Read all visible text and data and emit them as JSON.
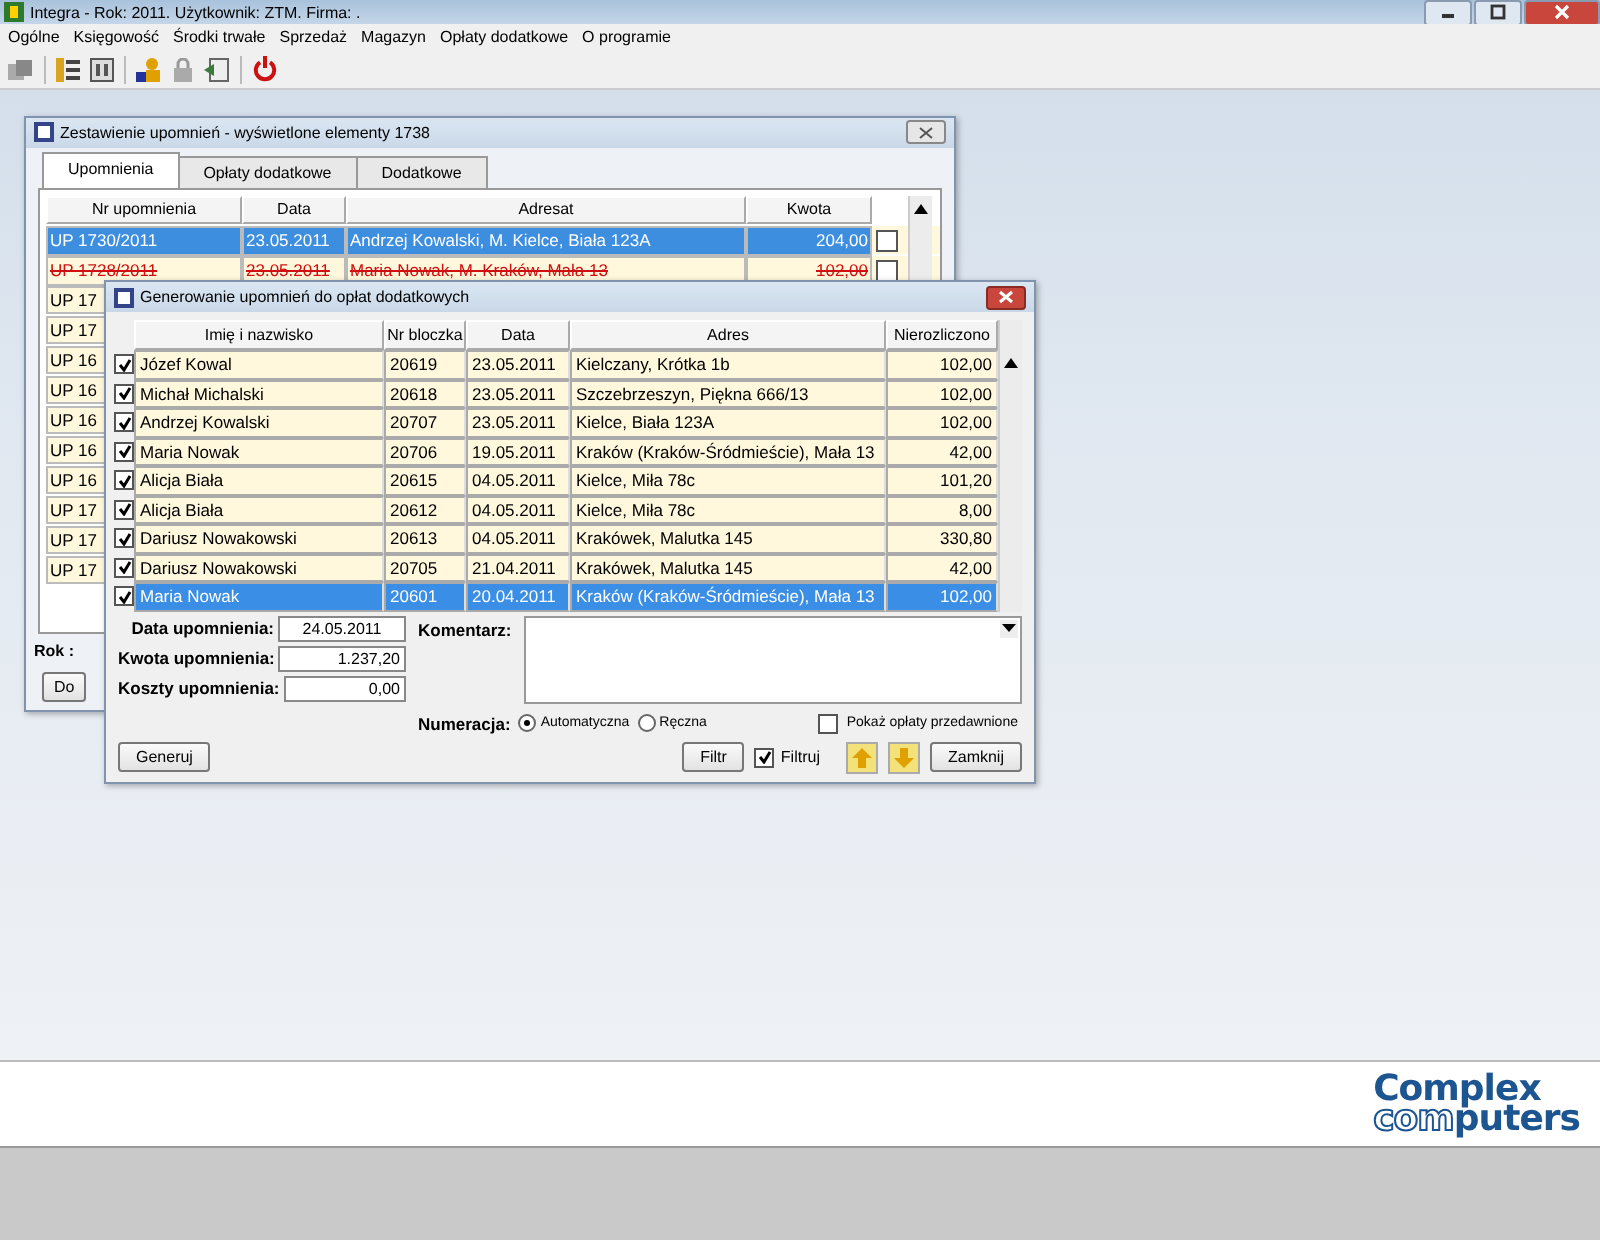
{
  "app": {
    "title": "Integra -  Rok: 2011. Użytkownik: ZTM. Firma: ."
  },
  "menu": [
    "Ogólne",
    "Księgowość",
    "Środki trwałe",
    "Sprzedaż",
    "Magazyn",
    "Opłaty dodatkowe",
    "O programie"
  ],
  "list_window": {
    "title": "Zestawienie upomnień - wyświetlone elementy 1738",
    "tabs": [
      {
        "label": "Upomnienia",
        "selected": true
      },
      {
        "label": "Opłaty dodatkowe",
        "selected": false
      },
      {
        "label": "Dodatkowe",
        "selected": false
      }
    ],
    "columns": [
      "Nr upomnienia",
      "Data",
      "Adresat",
      "Kwota"
    ],
    "rows": [
      {
        "number": "UP 1730/2011",
        "date": "23.05.2011",
        "addressee": "Andrzej Kowalski, M. Kielce, Biała 123A",
        "amount": "204,00",
        "selected": true,
        "cancelled": false,
        "checked": false
      },
      {
        "number": "UP 1728/2011",
        "date": "23.05.2011",
        "addressee": "Maria Nowak, M. Kraków, Mała 13",
        "amount": "102,00",
        "selected": false,
        "cancelled": true,
        "checked": false
      },
      {
        "number": "UP 17",
        "selected": false,
        "cancelled": false
      },
      {
        "number": "UP 17",
        "selected": false,
        "cancelled": false
      },
      {
        "number": "UP 16",
        "selected": false,
        "cancelled": false
      },
      {
        "number": "UP 16",
        "selected": false,
        "cancelled": false
      },
      {
        "number": "UP 16",
        "selected": false,
        "cancelled": false
      },
      {
        "number": "UP 16",
        "selected": false,
        "cancelled": false
      },
      {
        "number": "UP 16",
        "selected": false,
        "cancelled": false
      },
      {
        "number": "UP 17",
        "selected": false,
        "cancelled": false
      },
      {
        "number": "UP 17",
        "selected": false,
        "cancelled": false
      },
      {
        "number": "UP 17",
        "selected": false,
        "cancelled": false
      }
    ],
    "year_label": "Rok :",
    "button": "Do"
  },
  "dialog": {
    "title": "Generowanie upomnień do opłat dodatkowych",
    "columns": [
      "Imię i nazwisko",
      "Nr bloczka",
      "Data",
      "Adres",
      "Nierozliczono"
    ],
    "rows": [
      {
        "checked": true,
        "name": "Józef Kowal",
        "block": "20619",
        "date": "23.05.2011",
        "address": "Kielczany, Krótka 1b",
        "amount": "102,00",
        "selected": false
      },
      {
        "checked": true,
        "name": "Michał Michalski",
        "block": "20618",
        "date": "23.05.2011",
        "address": "Szczebrzeszyn, Piękna 666/13",
        "amount": "102,00",
        "selected": false
      },
      {
        "checked": true,
        "name": "Andrzej Kowalski",
        "block": "20707",
        "date": "23.05.2011",
        "address": "Kielce, Biała 123A",
        "amount": "102,00",
        "selected": false
      },
      {
        "checked": true,
        "name": "Maria Nowak",
        "block": "20706",
        "date": "19.05.2011",
        "address": "Kraków (Kraków-Śródmieście), Mała 13",
        "amount": "42,00",
        "selected": false
      },
      {
        "checked": true,
        "name": "Alicja Biała",
        "block": "20615",
        "date": "04.05.2011",
        "address": "Kielce, Miła 78c",
        "amount": "101,20",
        "selected": false
      },
      {
        "checked": true,
        "name": "Alicja Biała",
        "block": "20612",
        "date": "04.05.2011",
        "address": "Kielce, Miła 78c",
        "amount": "8,00",
        "selected": false
      },
      {
        "checked": true,
        "name": "Dariusz Nowakowski",
        "block": "20613",
        "date": "04.05.2011",
        "address": "Krakówek, Malutka 145",
        "amount": "330,80",
        "selected": false
      },
      {
        "checked": true,
        "name": "Dariusz Nowakowski",
        "block": "20705",
        "date": "21.04.2011",
        "address": "Krakówek, Malutka 145",
        "amount": "42,00",
        "selected": false
      },
      {
        "checked": true,
        "name": "Maria Nowak",
        "block": "20601",
        "date": "20.04.2011",
        "address": "Kraków (Kraków-Śródmieście), Mała 13",
        "amount": "102,00",
        "selected": true
      }
    ],
    "fields": [
      {
        "label": "Data upomnienia:",
        "value": "24.05.2011"
      },
      {
        "label": "Kwota upomnienia:",
        "value": "1.237,20"
      },
      {
        "label": "Koszty upomnienia:",
        "value": "0,00"
      }
    ],
    "comment_label": "Komentarz:",
    "numbering_label": "Numeracja:",
    "numbering": [
      {
        "label": "Automatyczna",
        "selected": true
      },
      {
        "label": "Ręczna",
        "selected": false
      }
    ],
    "show_expired": {
      "label": "Pokaż opłaty przedawnione",
      "checked": false
    },
    "generate_button": "Generuj",
    "filter_button": "Filtr",
    "filter_toggle": {
      "label": "Filtruj",
      "checked": true
    },
    "close_button": "Zamknij"
  },
  "logo": {
    "line_1": "Complex",
    "line_2_outlined": "com",
    "line_2_rest": "puters"
  }
}
